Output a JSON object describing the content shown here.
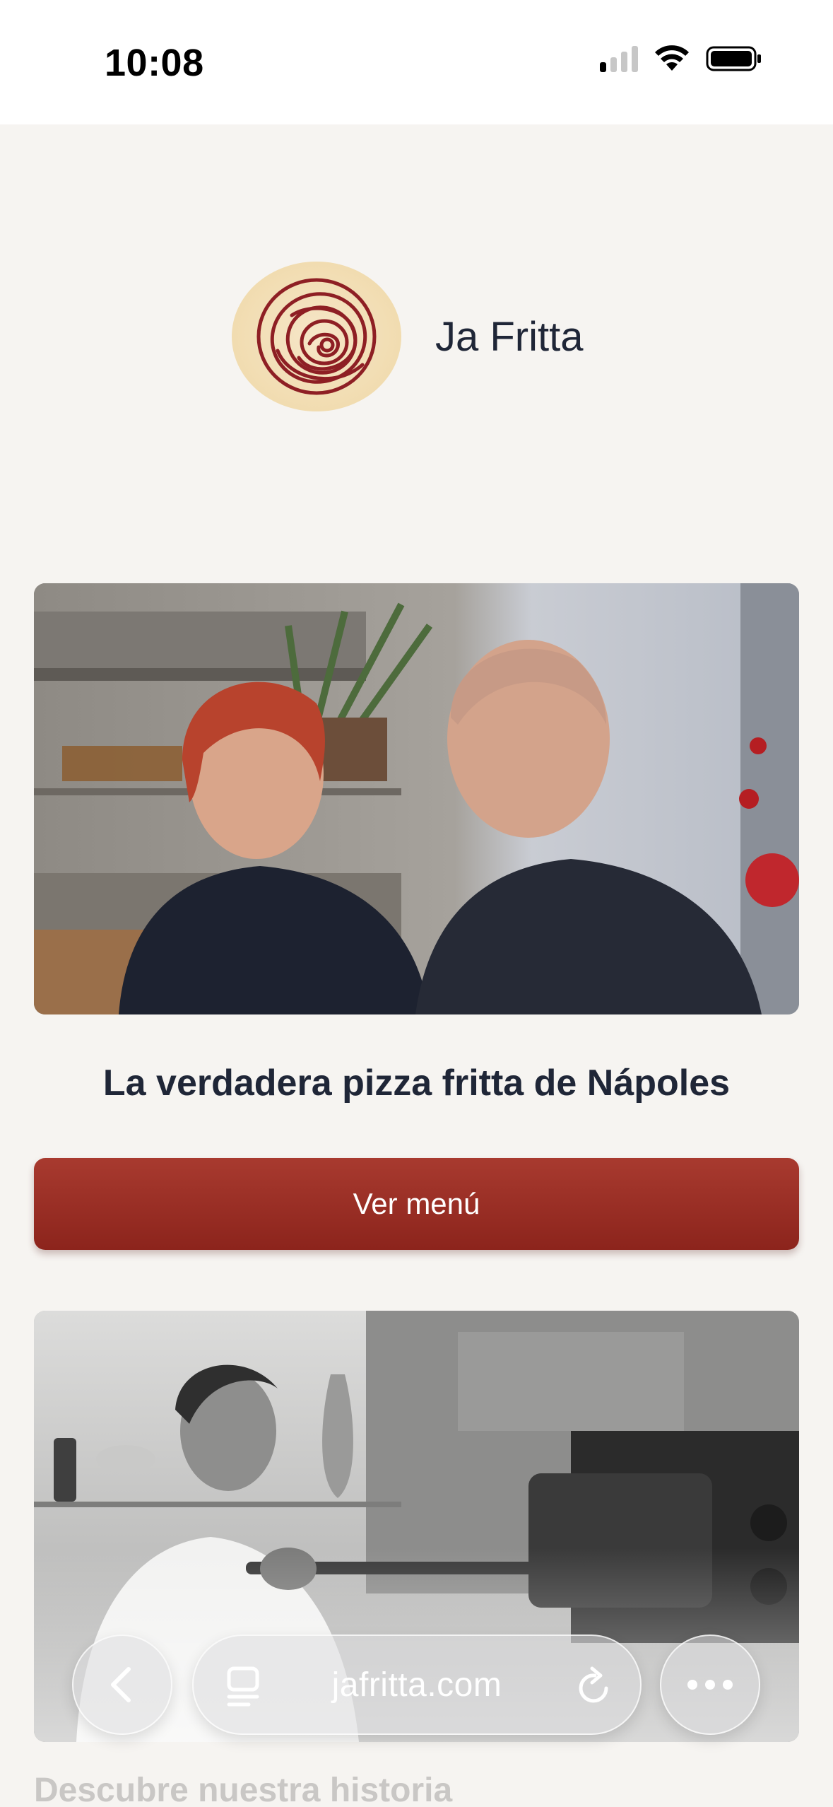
{
  "status_bar": {
    "time": "10:08"
  },
  "header": {
    "restaurant_name": "Ja Fritta"
  },
  "hero": {
    "tagline": "La verdadera pizza fritta de Nápoles"
  },
  "actions": {
    "menu_button_label": "Ver menú"
  },
  "story": {
    "section_title": "Descubre nuestra historia"
  },
  "browser": {
    "url": "jafritta.com"
  },
  "colors": {
    "accent": "#9b2f25",
    "background": "#f6f4f1",
    "text": "#1f2637"
  },
  "icons": [
    "signal-icon",
    "wifi-icon",
    "battery-icon",
    "back-icon",
    "reader-icon",
    "reload-icon",
    "more-icon"
  ]
}
